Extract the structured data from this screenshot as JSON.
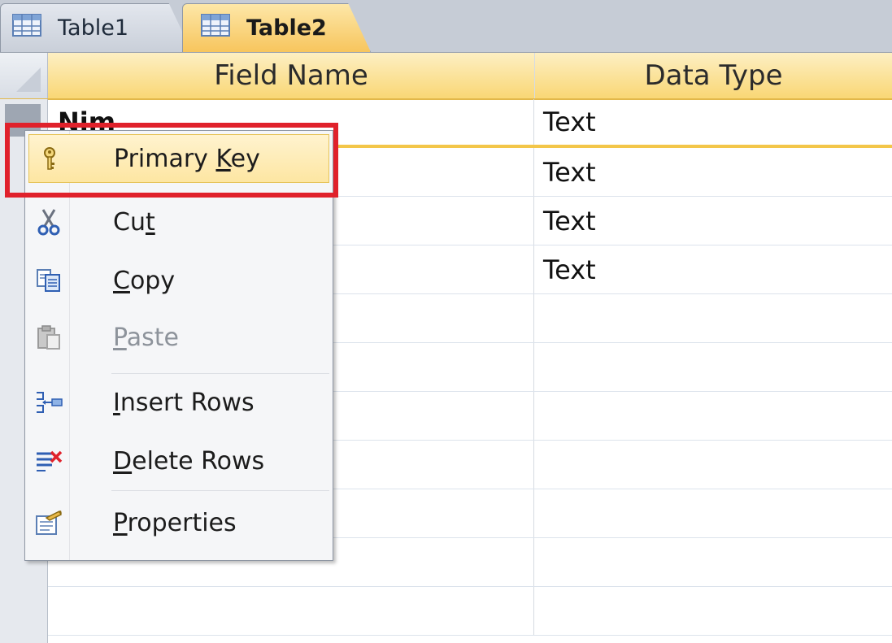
{
  "tabs": [
    {
      "label": "Table1",
      "active": false,
      "icon": "table-icon"
    },
    {
      "label": "Table2",
      "active": true,
      "icon": "table-icon"
    }
  ],
  "grid": {
    "columns": [
      "Field Name",
      "Data Type"
    ],
    "rows": [
      {
        "field_name": "Nim",
        "data_type": "Text"
      },
      {
        "field_name": "",
        "data_type": "Text"
      },
      {
        "field_name": "",
        "data_type": "Text"
      },
      {
        "field_name": "",
        "data_type": "Text"
      },
      {
        "field_name": "",
        "data_type": ""
      },
      {
        "field_name": "",
        "data_type": ""
      },
      {
        "field_name": "",
        "data_type": ""
      },
      {
        "field_name": "",
        "data_type": ""
      },
      {
        "field_name": "",
        "data_type": ""
      },
      {
        "field_name": "",
        "data_type": ""
      },
      {
        "field_name": "",
        "data_type": ""
      }
    ]
  },
  "context_menu": {
    "items": [
      {
        "id": "primary-key",
        "before": "Primary ",
        "accel": "K",
        "after": "ey",
        "icon": "key-icon",
        "enabled": true,
        "highlighted": true
      },
      {
        "id": "cut",
        "before": "Cu",
        "accel": "t",
        "after": "",
        "icon": "scissors-icon",
        "enabled": true
      },
      {
        "id": "copy",
        "before": "",
        "accel": "C",
        "after": "opy",
        "icon": "copy-icon",
        "enabled": true
      },
      {
        "id": "paste",
        "before": "",
        "accel": "P",
        "after": "aste",
        "icon": "paste-icon",
        "enabled": false
      },
      {
        "id": "insert-rows",
        "before": "",
        "accel": "I",
        "after": "nsert Rows",
        "icon": "insert-rows-icon",
        "enabled": true
      },
      {
        "id": "delete-rows",
        "before": "",
        "accel": "D",
        "after": "elete Rows",
        "icon": "delete-rows-icon",
        "enabled": true
      },
      {
        "id": "properties",
        "before": "",
        "accel": "P",
        "after": "roperties",
        "icon": "properties-icon",
        "enabled": true
      }
    ]
  },
  "colors": {
    "highlight_box": "#e0212b",
    "active_tab": "#f7c55d",
    "header": "#f9d775"
  }
}
